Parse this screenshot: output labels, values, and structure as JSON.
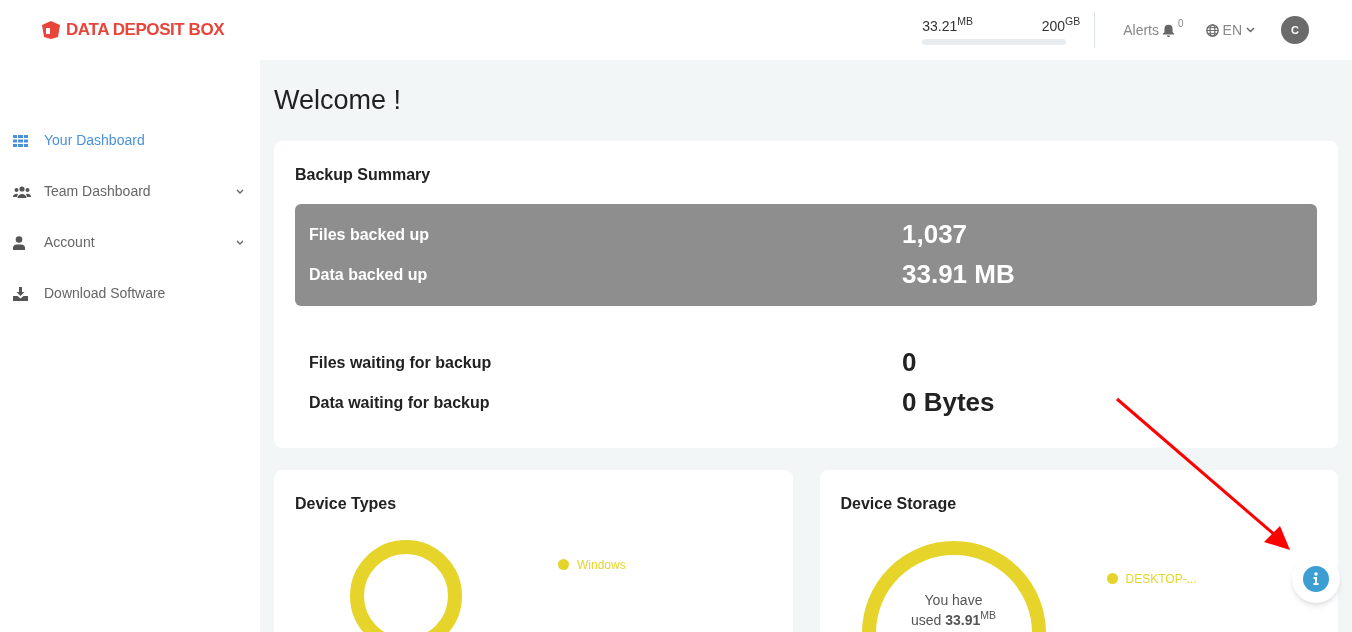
{
  "brand": {
    "name": "DATA DEPOSIT BOX"
  },
  "header": {
    "storage_used": "33.21$^{MB}$",
    "storage_total": "200$^{GB}$",
    "alerts_label": "Alerts",
    "alerts_count": "0",
    "language": "EN",
    "avatar_initial": "C"
  },
  "sidebar": {
    "items": [
      {
        "label": "Your Dashboard",
        "selected": true,
        "has_submenu": false
      },
      {
        "label": "Team Dashboard",
        "selected": false,
        "has_submenu": true
      },
      {
        "label": "Account",
        "selected": false,
        "has_submenu": true
      },
      {
        "label": "Download Software",
        "selected": false,
        "has_submenu": false
      }
    ]
  },
  "page_title": "Welcome !",
  "backup_summary": {
    "title": "Backup Summary",
    "backed_up": [
      {
        "label": "Files backed up",
        "value": "1,037"
      },
      {
        "label": "Data backed up",
        "value": "33.91 MB"
      }
    ],
    "waiting": [
      {
        "label": "Files waiting for backup",
        "value": "0"
      },
      {
        "label": "Data waiting for backup",
        "value": "0 Bytes"
      }
    ]
  },
  "device_types": {
    "title": "Device Types",
    "legend": [
      {
        "label": "Windows",
        "color": "#e6d42a"
      }
    ]
  },
  "device_storage": {
    "title": "Device Storage",
    "center_line1": "You have",
    "center_line2": "used **33.91**$^{MB}$",
    "legend": [
      {
        "label": "DESKTOP-...",
        "color": "#e6d42a"
      }
    ]
  }
}
